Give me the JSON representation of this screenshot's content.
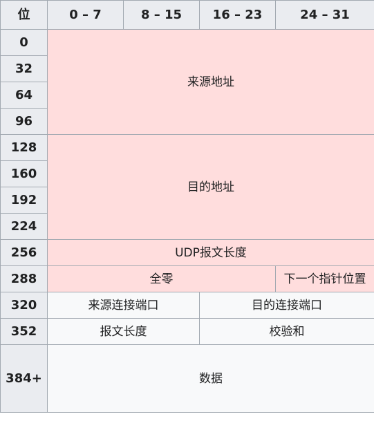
{
  "header": {
    "col_bit": "位",
    "col_0_7": "0 – 7",
    "col_8_15": "8 – 15",
    "col_16_23": "16 – 23",
    "col_24_31": "24 – 31"
  },
  "rows": {
    "r0": "0",
    "r32": "32",
    "r64": "64",
    "r96": "96",
    "r128": "128",
    "r160": "160",
    "r192": "192",
    "r224": "224",
    "r256": "256",
    "r288": "288",
    "r320": "320",
    "r352": "352",
    "r384": "384+"
  },
  "fields": {
    "source_address": "来源地址",
    "destination_address": "目的地址",
    "udp_length": "UDP报文长度",
    "zeros": "全零",
    "next_pointer": "下一个指针位置",
    "source_port": "来源连接端口",
    "destination_port": "目的连接端口",
    "length": "报文长度",
    "checksum": "校验和",
    "data": "数据"
  },
  "colors": {
    "pseudo_header_bg": "#ffdddd",
    "header_bg": "#eaecf0",
    "cell_bg": "#f8f9fa",
    "border": "#a2a9b1"
  }
}
